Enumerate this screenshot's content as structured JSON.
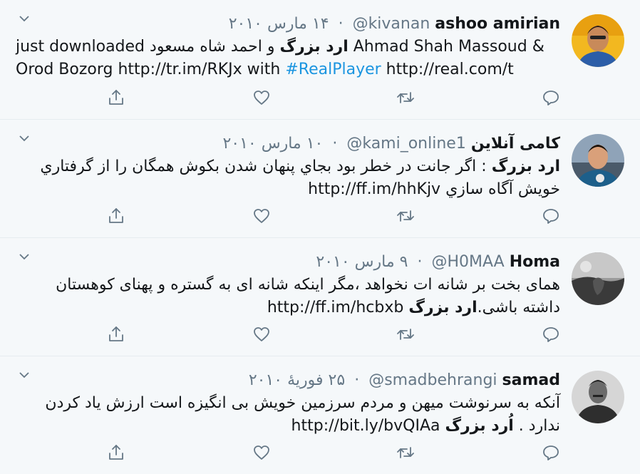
{
  "colors": {
    "background": "#f5f8fa",
    "text": "#14171a",
    "secondary": "#657786",
    "link": "#1b95e0",
    "divider": "#e6ecf0"
  },
  "tweets": [
    {
      "name": "ashoo amirian",
      "handle": "@kivanan",
      "date": "۱۴ مارس ۲۰۱۰",
      "direction": "ltr",
      "body": {
        "p1": "just downloaded ",
        "b1": "ارد بزرگ",
        "p2": "  و  ",
        "p3": "احمد شاه مسعود",
        "p4": "  Ahmad Shah Massoud & Orod Bozorg http://tr.im/RKJx with ",
        "tag": "#RealPlayer",
        "p5": " http://real.com/t"
      }
    },
    {
      "name": "کامی آنلاین",
      "handle": "@kami_online1",
      "date": "۱۰ مارس ۲۰۱۰",
      "direction": "rtl",
      "body": {
        "b1": "ارد بزرگ",
        "p1": " : اگر جانت در خطر بود بجاي پنهان شدن بكوش همگان را از گرفتاري خويش آگاه سازي ",
        "url": "http://ff.im/hhKjv"
      }
    },
    {
      "name": "Homa",
      "handle": "@H0MAA",
      "date": "۹ مارس ۲۰۱۰",
      "direction": "rtl",
      "body": {
        "p1": "همای بخت بر شانه ات نخواهد ،مگر اینکه شانه ای به گستره و پهنای کوهستان داشته باشی.",
        "b1": "ارد بزرگ",
        "url": " http://ff.im/hcbxb"
      }
    },
    {
      "name": "samad",
      "handle": "@smadbehrangi",
      "date": "۲۵ فوریهٔ ۲۰۱۰",
      "direction": "rtl",
      "body": {
        "p1": "آنکه به سرنوشت میهن و مردم سرزمین خویش بی انگیزه است ارزش یاد کردن ندارد . ",
        "b1": "اُرد بزرگ",
        "url": " http://bit.ly/bvQIAa"
      }
    }
  ],
  "icons": {
    "reply": "reply-icon",
    "retweet": "retweet-icon",
    "like": "heart-icon",
    "share": "share-icon",
    "menu": "chevron-down-icon"
  }
}
